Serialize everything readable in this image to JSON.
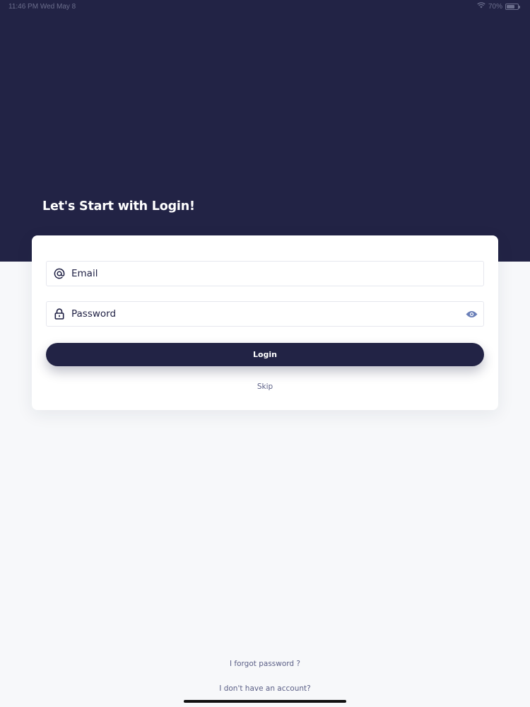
{
  "status_bar": {
    "time": "11:46 PM   Wed May 8",
    "battery": "70%"
  },
  "header": {
    "title": "Let's Start with Login!"
  },
  "login_form": {
    "email": {
      "placeholder": "Email",
      "value": "",
      "icon": "at-icon"
    },
    "password": {
      "placeholder": "Password",
      "value": "",
      "icon": "lock-icon",
      "toggle_icon": "eye-icon"
    },
    "login_label": "Login",
    "skip_label": "Skip"
  },
  "footer": {
    "forgot_password": "I forgot password ?",
    "no_account": "I don't have an account?"
  },
  "colors": {
    "primary": "#222345",
    "background": "#f7f8fa",
    "card": "#ffffff",
    "link": "#5b5f86",
    "eye_icon": "#6a7fb8"
  }
}
